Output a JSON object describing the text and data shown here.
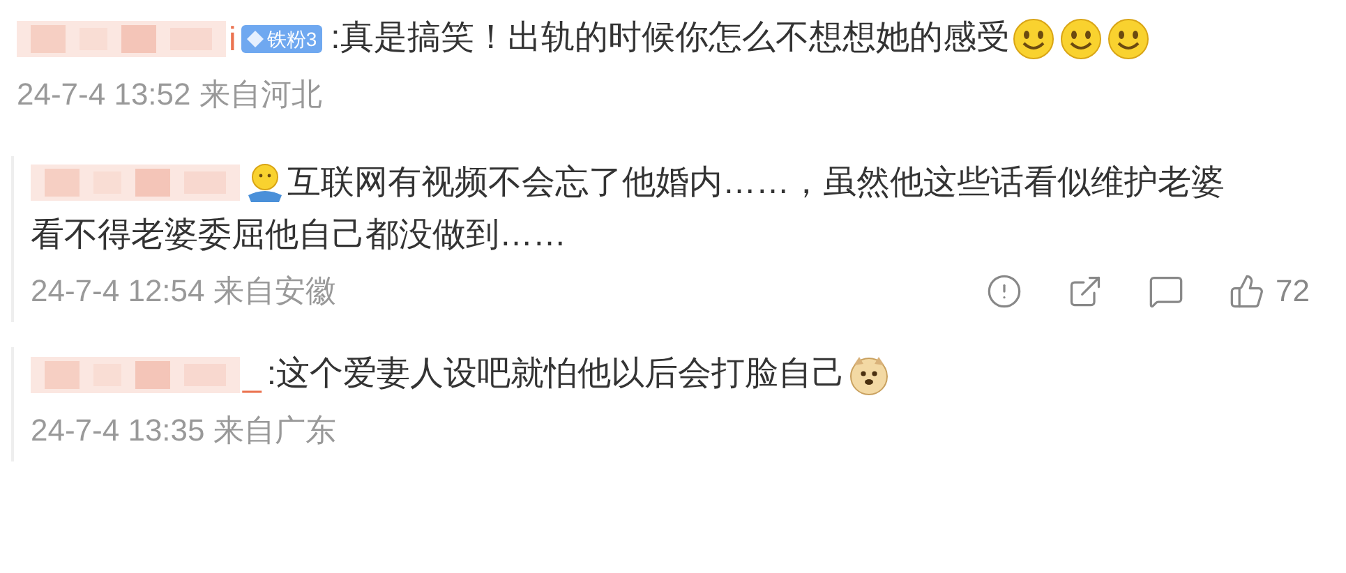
{
  "comments": [
    {
      "boxed": false,
      "name_tail": "i",
      "badge": "铁粉3",
      "content": [
        {
          "kind": "text",
          "text": ":真是搞笑！出轨的时候你怎么不想想她的感受"
        },
        {
          "kind": "smile"
        },
        {
          "kind": "smile"
        },
        {
          "kind": "smile"
        }
      ],
      "time": "24-7-4 13:52 来自河北"
    },
    {
      "boxed": true,
      "content": [
        {
          "kind": "shrug"
        },
        {
          "kind": "text",
          "text": "互联网有视频不会忘了他婚内……，虽然他这些话看似维护老婆"
        },
        {
          "kind": "line",
          "text": "看不得老婆委屈他自己都没做到……"
        }
      ],
      "time": "24-7-4 12:54 来自安徽",
      "actions": [
        {
          "kind": "report"
        },
        {
          "kind": "share"
        },
        {
          "kind": "comment"
        },
        {
          "kind": "like",
          "count": "72"
        }
      ]
    },
    {
      "boxed": true,
      "name_tail": "_",
      "content": [
        {
          "kind": "text",
          "text": ":这个爱妻人设吧就怕他以后会打脸自己"
        },
        {
          "kind": "doge"
        }
      ],
      "time": "24-7-4 13:35 来自广东"
    }
  ]
}
